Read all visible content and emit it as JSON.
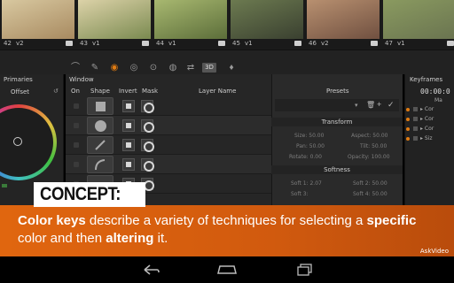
{
  "thumbnails": [
    {
      "label": "42",
      "suffix": "v2",
      "colors": [
        "#d8c8a0",
        "#a88a60"
      ]
    },
    {
      "label": "43",
      "suffix": "v1",
      "colors": [
        "#dcd2a8",
        "#7a8a50"
      ],
      "selected": true
    },
    {
      "label": "44",
      "suffix": "v1",
      "colors": [
        "#a8b870",
        "#5c6e3a"
      ]
    },
    {
      "label": "45",
      "suffix": "v1",
      "colors": [
        "#6c7a50",
        "#3a4030"
      ]
    },
    {
      "label": "46",
      "suffix": "v2",
      "colors": [
        "#b89070",
        "#705040"
      ]
    },
    {
      "label": "47",
      "suffix": "v1",
      "colors": [
        "#8a9a60",
        "#6a7450"
      ]
    }
  ],
  "toolbar": {
    "tools": [
      "curve-icon",
      "eyedropper-icon",
      "qualifier-icon",
      "window-icon",
      "tracker-icon",
      "blur-icon",
      "key-icon"
    ],
    "three_d_label": "3D"
  },
  "primaries": {
    "title": "Primaries",
    "offset_label": "Offset"
  },
  "window_panel": {
    "title": "Window",
    "columns": {
      "on": "On",
      "shape": "Shape",
      "invert": "Invert",
      "mask": "Mask",
      "layer_name": "Layer Name"
    }
  },
  "presets": {
    "title": "Presets",
    "transform_title": "Transform",
    "fields": {
      "size": "Size: 50.00",
      "aspect": "Aspect: 50.00",
      "pan": "Pan: 50.00",
      "tilt": "Tilt: 50.00",
      "rotate": "Rotate: 0.00",
      "opacity": "Opacity: 100.00"
    },
    "softness_title": "Softness",
    "softness": {
      "soft1": "Soft 1: 2.07",
      "soft2": "Soft 2: 50.00",
      "soft3": "Soft 3:",
      "soft4": "Soft 4: 50.00"
    }
  },
  "keyframes": {
    "title": "Keyframes",
    "timecode": "00:00:0",
    "rows": [
      "Ma",
      "Cor",
      "Cor",
      "Cor",
      "Siz"
    ]
  },
  "overlay": {
    "concept_label": "CONCEPT:",
    "text_parts": [
      {
        "text": "Color keys",
        "bold": true
      },
      {
        "text": " describe a variety of techniques for selecting a ",
        "bold": false
      },
      {
        "text": "specific",
        "bold": true
      },
      {
        "text": " color and then ",
        "bold": false
      },
      {
        "text": "altering",
        "bold": true
      },
      {
        "text": " it.",
        "bold": false
      }
    ],
    "watermark": "AskVideo",
    "accent": "#e0660f"
  },
  "navbar": {
    "back": "back-icon",
    "home": "home-icon",
    "recents": "recents-icon"
  }
}
